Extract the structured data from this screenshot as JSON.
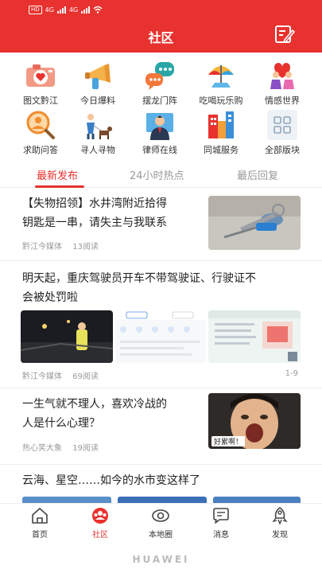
{
  "status_bar": {
    "hd": "HD",
    "net1": "4G",
    "net2": "4G"
  },
  "header": {
    "title": "社区"
  },
  "grid": [
    {
      "label": "图文黔江",
      "icon": "camera-heart-icon"
    },
    {
      "label": "今日爆料",
      "icon": "megaphone-icon"
    },
    {
      "label": "摆龙门阵",
      "icon": "chat-bubbles-icon"
    },
    {
      "label": "吃喝玩乐购",
      "icon": "beach-umbrella-icon"
    },
    {
      "label": "情感世界",
      "icon": "couple-icon"
    },
    {
      "label": "求助问答",
      "icon": "magnifier-person-icon"
    },
    {
      "label": "寻人寻物",
      "icon": "person-dog-icon"
    },
    {
      "label": "律师在线",
      "icon": "lawyer-icon"
    },
    {
      "label": "同城服务",
      "icon": "city-buildings-icon"
    },
    {
      "label": "全部版块",
      "icon": "all-sections-icon"
    }
  ],
  "tabs": [
    "最新发布",
    "24小时热点",
    "最后回复"
  ],
  "articles": [
    {
      "title_l1": "【失物招领】水井湾附近拾得",
      "title_l2": "钥匙是一串，请失主与我联系",
      "source": "黔江今媒体",
      "reads": "13阅读"
    },
    {
      "title_l1": "明天起，重庆驾驶员开车不带驾驶证、行驶证不",
      "title_l2": "会被处罚啦",
      "source": "黔江今媒体",
      "reads": "69阅读",
      "pager": "1-9",
      "thumb2": {
        "tab1": "电子证照",
        "tab2": "电子证照"
      },
      "thumb3": {
        "title": "电子驾驶证"
      }
    },
    {
      "title_l1": "一生气就不理人，喜欢冷战的",
      "title_l2": "人是什么心理？",
      "source": "热心笑大象",
      "reads": "19阅读",
      "caption": "好累啊！"
    },
    {
      "title_l1": "云海、星空……如今的水市变这样了"
    }
  ],
  "bottom_nav": [
    {
      "label": "首页",
      "icon": "home-icon"
    },
    {
      "label": "社区",
      "icon": "community-icon"
    },
    {
      "label": "本地圈",
      "icon": "local-circle-icon"
    },
    {
      "label": "消息",
      "icon": "message-icon"
    },
    {
      "label": "发现",
      "icon": "rocket-icon"
    }
  ],
  "brand": "HUAWEI",
  "colors": {
    "accent": "#e8322f"
  }
}
